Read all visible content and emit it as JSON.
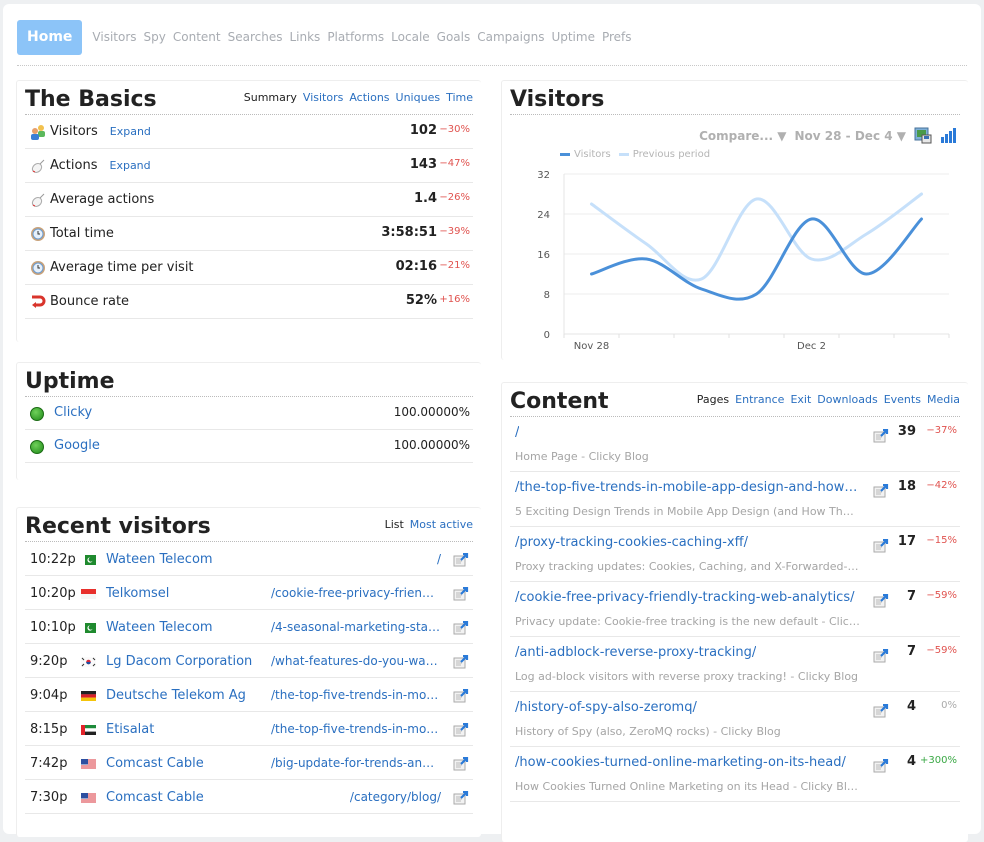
{
  "nav": {
    "home": "Home",
    "items": [
      "Visitors",
      "Spy",
      "Content",
      "Searches",
      "Links",
      "Platforms",
      "Locale",
      "Goals",
      "Campaigns",
      "Uptime",
      "Prefs"
    ]
  },
  "basics": {
    "title": "The Basics",
    "tabs": [
      {
        "label": "Summary",
        "active": true
      },
      {
        "label": "Visitors",
        "active": false
      },
      {
        "label": "Actions",
        "active": false
      },
      {
        "label": "Uniques",
        "active": false
      },
      {
        "label": "Time",
        "active": false
      }
    ],
    "rows": [
      {
        "icon": "visitors-icon",
        "label": "Visitors",
        "expand": "Expand",
        "value": "102",
        "change": "-30%"
      },
      {
        "icon": "mouse-icon",
        "label": "Actions",
        "expand": "Expand",
        "value": "143",
        "change": "-47%"
      },
      {
        "icon": "mouse-icon",
        "label": "Average actions",
        "value": "1.4",
        "change": "-26%"
      },
      {
        "icon": "clock-icon",
        "label": "Total time",
        "value": "3:58:51",
        "change": "-39%"
      },
      {
        "icon": "clock-icon",
        "label": "Average time per visit",
        "value": "02:16",
        "change": "-21%"
      },
      {
        "icon": "bounce-icon",
        "label": "Bounce rate",
        "value": "52%",
        "change": "+16%"
      }
    ]
  },
  "uptime": {
    "title": "Uptime",
    "rows": [
      {
        "name": "Clicky",
        "pct": "100.00000%",
        "status": "up"
      },
      {
        "name": "Google",
        "pct": "100.00000%",
        "status": "up"
      }
    ]
  },
  "recent": {
    "title": "Recent visitors",
    "tabs": [
      {
        "label": "List",
        "active": true
      },
      {
        "label": "Most active",
        "active": false
      }
    ],
    "rows": [
      {
        "time": "10:22p",
        "flag": "pk",
        "org": "Wateen Telecom",
        "path": "/"
      },
      {
        "time": "10:20p",
        "flag": "id",
        "org": "Telkomsel",
        "path": "/cookie-free-privacy-friendl..."
      },
      {
        "time": "10:10p",
        "flag": "pk",
        "org": "Wateen Telecom",
        "path": "/4-seasonal-marketing-stats..."
      },
      {
        "time": "9:20p",
        "flag": "kr",
        "org": "Lg Dacom Corporation",
        "path": "/what-features-do-you-want/"
      },
      {
        "time": "9:04p",
        "flag": "de",
        "org": "Deutsche Telekom Ag",
        "path": "/the-top-five-trends-in-mob..."
      },
      {
        "time": "8:15p",
        "flag": "ae",
        "org": "Etisalat",
        "path": "/the-top-five-trends-in-mob..."
      },
      {
        "time": "7:42p",
        "flag": "us",
        "org": "Comcast Cable",
        "path": "/big-update-for-trends-and-..."
      },
      {
        "time": "7:30p",
        "flag": "us",
        "org": "Comcast Cable",
        "path": "/category/blog/"
      }
    ]
  },
  "visitors_panel": {
    "title": "Visitors",
    "compare": "Compare...",
    "date_range": "Nov 28 - Dec 4"
  },
  "chart_data": {
    "type": "line",
    "title": "",
    "xlabel": "",
    "ylabel": "",
    "x": [
      "Nov 28",
      "Nov 29",
      "Nov 30",
      "Dec 1",
      "Dec 2",
      "Dec 3",
      "Dec 4"
    ],
    "x_tick_labels": [
      "Nov 28",
      "Dec 2"
    ],
    "y_ticks": [
      0,
      8,
      16,
      24,
      32
    ],
    "ylim": [
      0,
      32
    ],
    "grid": true,
    "legend": "top-left",
    "series": [
      {
        "name": "Visitors",
        "color": "#4a90d9",
        "values": [
          12,
          15,
          9,
          8,
          23,
          12,
          23
        ]
      },
      {
        "name": "Previous period",
        "color": "#c6e0fa",
        "values": [
          26,
          18,
          11,
          27,
          15,
          20,
          28
        ]
      }
    ]
  },
  "content": {
    "title": "Content",
    "tabs": [
      {
        "label": "Pages",
        "active": true
      },
      {
        "label": "Entrance",
        "active": false
      },
      {
        "label": "Exit",
        "active": false
      },
      {
        "label": "Downloads",
        "active": false
      },
      {
        "label": "Events",
        "active": false
      },
      {
        "label": "Media",
        "active": false
      }
    ],
    "rows": [
      {
        "path": "/",
        "title": "Home Page - Clicky Blog",
        "count": "39",
        "change": "-37%"
      },
      {
        "path": "/the-top-five-trends-in-mobile-app-design-and-how-they-...",
        "title": "5 Exciting Design Trends in Mobile App Design (and How They I...",
        "count": "18",
        "change": "-42%"
      },
      {
        "path": "/proxy-tracking-cookies-caching-xff/",
        "title": "Proxy tracking updates: Cookies, Caching, and X-Forwarded-F...",
        "count": "17",
        "change": "-15%"
      },
      {
        "path": "/cookie-free-privacy-friendly-tracking-web-analytics/",
        "title": "Privacy update: Cookie-free tracking is the new default - Click...",
        "count": "7",
        "change": "-59%"
      },
      {
        "path": "/anti-adblock-reverse-proxy-tracking/",
        "title": "Log ad-block visitors with reverse proxy tracking! - Clicky Blog",
        "count": "7",
        "change": "-59%"
      },
      {
        "path": "/history-of-spy-also-zeromq/",
        "title": "History of Spy (also, ZeroMQ rocks) - Clicky Blog",
        "count": "4",
        "change": "0%"
      },
      {
        "path": "/how-cookies-turned-online-marketing-on-its-head/",
        "title": "How Cookies Turned Online Marketing on its Head - Clicky Blog",
        "count": "4",
        "change": "+300%"
      }
    ]
  }
}
